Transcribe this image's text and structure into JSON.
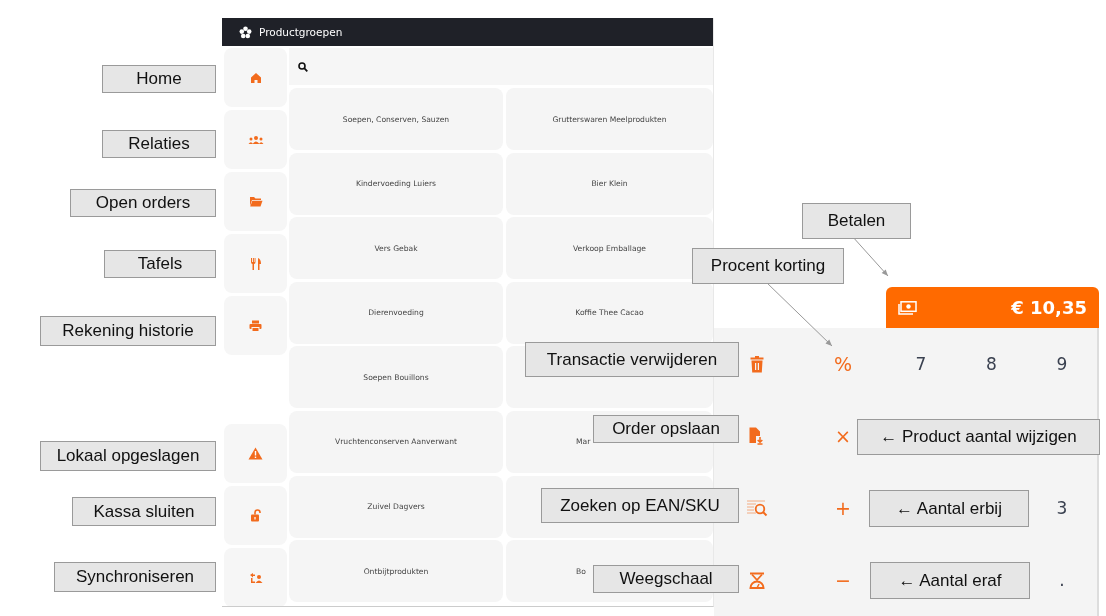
{
  "header": {
    "title": "Productgroepen"
  },
  "sidebar": {
    "top_items": [
      {
        "kind": "home"
      },
      {
        "kind": "people"
      },
      {
        "kind": "folder"
      },
      {
        "kind": "cutlery"
      },
      {
        "kind": "printer"
      }
    ],
    "bottom_items": [
      {
        "kind": "warning"
      },
      {
        "kind": "unlock"
      },
      {
        "kind": "sync"
      }
    ]
  },
  "product_groups": [
    {
      "label": "Soepen, Conserven, Sauzen"
    },
    {
      "label": "Grutterswaren Meelprodukten"
    },
    {
      "label": "Kindervoeding Luiers"
    },
    {
      "label": "Bier Klein"
    },
    {
      "label": "Vers Gebak"
    },
    {
      "label": "Verkoop Emballage"
    },
    {
      "label": "Dierenvoeding"
    },
    {
      "label": "Koffie Thee Cacao"
    },
    {
      "label": "Soepen Bouillons"
    },
    {
      "kind": "covered"
    },
    {
      "label": "Vruchtenconserven Aanverwant"
    },
    {
      "label": "Mar",
      "kind": "cut"
    },
    {
      "label": "Zuivel Dagvers"
    },
    {
      "kind": "covered"
    },
    {
      "label": "Ontbijtprodukten"
    },
    {
      "label": "Bo",
      "kind": "cut"
    }
  ],
  "payment": {
    "amount": "€ 10,35"
  },
  "keypad": {
    "rows": [
      {
        "tool": {
          "kind": "trash"
        },
        "operator": "%",
        "digits": {
          "col_1": "7",
          "col_2": "8",
          "col_3": "9"
        }
      },
      {
        "tool": {
          "kind": "file-save"
        },
        "operator": "×",
        "digits": {}
      },
      {
        "tool": {
          "kind": "barcode-search"
        },
        "operator": "+",
        "digits": {
          "col_3": "3"
        }
      },
      {
        "tool": {
          "kind": "scale"
        },
        "operator": "−",
        "digits": {
          "col_3": "."
        }
      }
    ]
  },
  "annotations": [
    {
      "text": "Home",
      "arrow": false
    },
    {
      "text": "Relaties",
      "arrow": false
    },
    {
      "text": "Open orders",
      "arrow": false
    },
    {
      "text": "Tafels",
      "arrow": false
    },
    {
      "text": "Rekening historie",
      "arrow": false
    },
    {
      "text": "Lokaal opgeslagen",
      "arrow": false
    },
    {
      "text": "Kassa sluiten",
      "arrow": false
    },
    {
      "text": "Synchroniseren",
      "arrow": false
    },
    {
      "text": "Betalen",
      "arrow": true
    },
    {
      "text": "Procent korting",
      "arrow": true
    },
    {
      "text": "Transactie verwijderen",
      "arrow": false
    },
    {
      "text": "Order opslaan",
      "arrow": false
    },
    {
      "text": "Zoeken op EAN/SKU",
      "arrow": false
    },
    {
      "text": "Weegschaal",
      "arrow": false
    },
    {
      "text": "← Product aantal wijzigen",
      "arrow": false
    },
    {
      "text": "← Aantal erbij",
      "arrow": false
    },
    {
      "text": "← Aantal eraf",
      "arrow": false
    }
  ]
}
